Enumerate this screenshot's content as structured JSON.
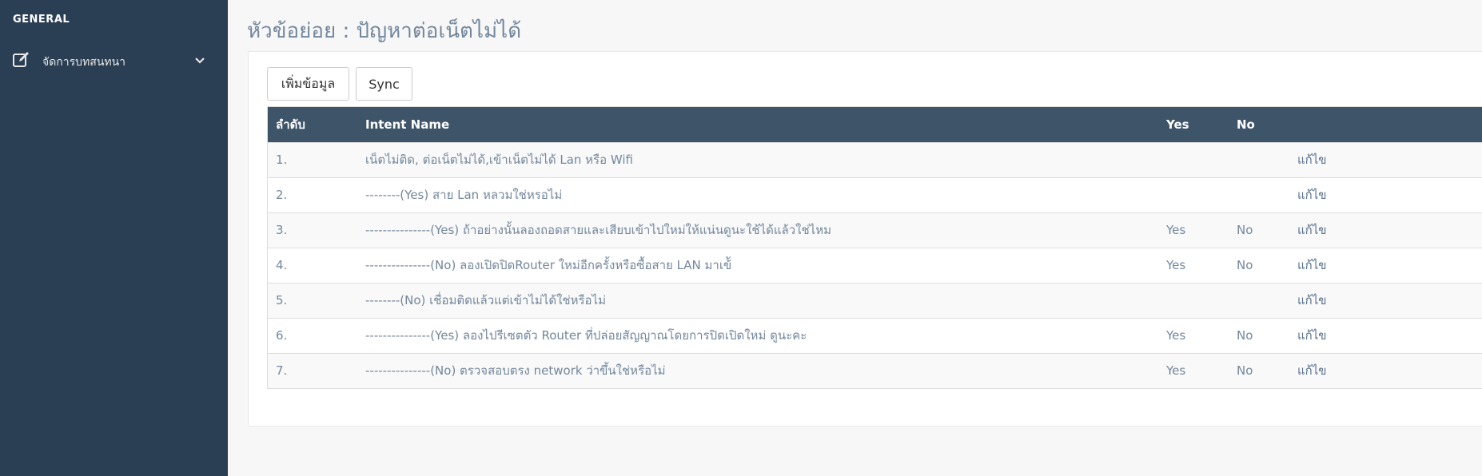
{
  "sidebar": {
    "section_title": "GENERAL",
    "menu_item": {
      "label": "จัดการบทสนทนา",
      "icon": "edit-icon"
    }
  },
  "page": {
    "title": "หัวข้อย่อย : ปัญหาต่อเน็ตไม่ได้"
  },
  "toolbar": {
    "add_label": "เพิ่มข้อมูล",
    "sync_label": "Sync"
  },
  "table": {
    "headers": {
      "num": "ลำดับ",
      "name": "Intent Name",
      "yes": "Yes",
      "no": "No",
      "action": ""
    },
    "rows": [
      {
        "num": "1.",
        "name": "เน็ตไม่ติด, ต่อเน็ตไม่ได้,เข้าเน็ตไม่ได้ Lan หรือ Wifi",
        "yes": "",
        "no": "",
        "action": "แก้ไข"
      },
      {
        "num": "2.",
        "name": "--------(Yes) สาย Lan หลวมใช่หรอไม่",
        "yes": "",
        "no": "",
        "action": "แก้ไข"
      },
      {
        "num": "3.",
        "name": "---------------(Yes) ถ้าอย่างนั้นลองถอดสายและเสียบเข้าไปใหม่ให้แน่นดูนะใช้ได้แล้วใช่ไหม",
        "yes": "Yes",
        "no": "No",
        "action": "แก้ไข"
      },
      {
        "num": "4.",
        "name": "---------------(No) ลองเปิดปิดRouter ใหม่อีกครั้งหรือซื้อสาย LAN มาเข้ั",
        "yes": "Yes",
        "no": "No",
        "action": "แก้ไข"
      },
      {
        "num": "5.",
        "name": "--------(No) เชื่อมติดแล้วแต่เข้าไม่ได้ใช่หรือไม่",
        "yes": "",
        "no": "",
        "action": "แก้ไข"
      },
      {
        "num": "6.",
        "name": "---------------(Yes) ลองไปรีเซตตัว Router ที่ปล่อยสัญญาณโดยการปิดเปิดใหม่ ดูนะคะ",
        "yes": "Yes",
        "no": "No",
        "action": "แก้ไข"
      },
      {
        "num": "7.",
        "name": "---------------(No) ตรวจสอบตรง network ว่าขึ้นใช่หรือไม่",
        "yes": "Yes",
        "no": "No",
        "action": "แก้ไข"
      }
    ]
  }
}
